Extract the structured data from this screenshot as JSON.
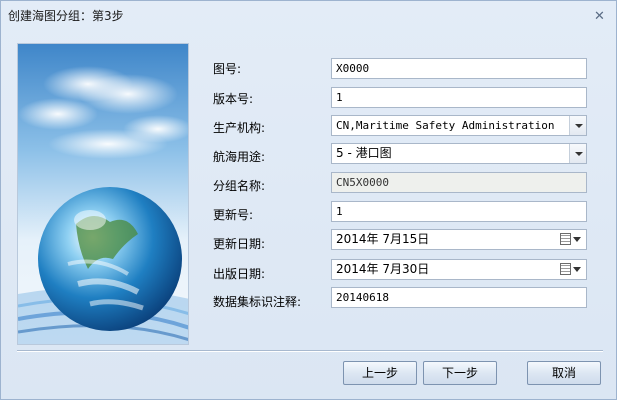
{
  "window": {
    "title": "创建海图分组：第3步",
    "close_glyph": "✕"
  },
  "form": {
    "fields": [
      {
        "label": "图号:",
        "value": "X0000",
        "type": "text"
      },
      {
        "label": "版本号:",
        "value": "1",
        "type": "text"
      },
      {
        "label": "生产机构:",
        "value": "CN,Maritime Safety Administration",
        "type": "dropdown"
      },
      {
        "label": "航海用途:",
        "value": "5 - 港口图",
        "type": "dropdown"
      },
      {
        "label": "分组名称:",
        "value": "CN5X0000",
        "type": "readonly"
      },
      {
        "label": "更新号:",
        "value": "1",
        "type": "text"
      },
      {
        "label": "更新日期:",
        "value": "2014年 7月15日",
        "type": "date"
      },
      {
        "label": "出版日期:",
        "value": "2014年 7月30日",
        "type": "date"
      },
      {
        "label": "数据集标识注释:",
        "value": "20140618",
        "type": "text"
      }
    ]
  },
  "buttons": {
    "prev": "上一步",
    "next": "下一步",
    "cancel": "取消"
  },
  "icons": {
    "close": "close-icon",
    "dropdown": "chevron-down-icon",
    "calendar": "calendar-icon"
  }
}
